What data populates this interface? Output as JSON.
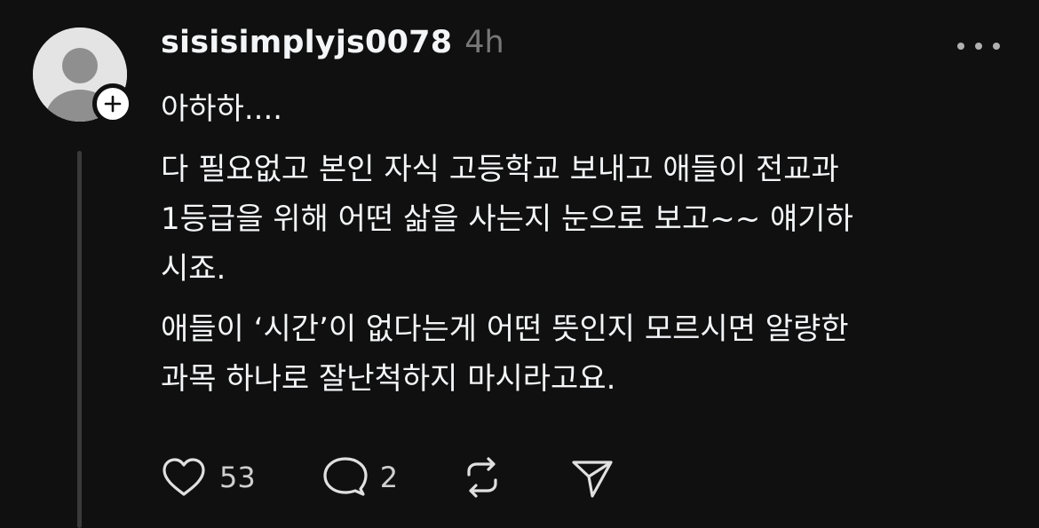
{
  "post": {
    "username": "sisisimplyjs0078",
    "timestamp": "4h",
    "paragraphs": [
      "아하하....",
      "다 필요없고 본인 자식 고등학교 보내고 애들이 전교과 1등급을 위해 어떤 삶을 사는지 눈으로 보고~~ 얘기하시죠.",
      "애들이 ‘시간’이 없다는게 어떤 뜻인지 모르시면 알량한 과목 하나로 잘난척하지 마시라고요."
    ],
    "lines": [
      [
        "아하하...."
      ],
      [
        "다 필요없고 본인 자식 고등학교 보내고 애들이 전교과",
        "1등급을 위해 어떤 삶을 사는지 눈으로 보고~~ 얘기하",
        "시죠."
      ],
      [
        "애들이 ‘시간’이 없다는게 어떤 뜻인지 모르시면 알량한",
        "과목 하나로 잘난척하지 마시라고요."
      ]
    ]
  },
  "actions": {
    "likes": "53",
    "replies": "2"
  },
  "icons": {
    "avatar": "default-user-avatar",
    "follow": "plus-icon",
    "more": "more-horizontal-icon",
    "like": "heart-icon",
    "reply": "comment-icon",
    "repost": "repost-icon",
    "share": "send-icon"
  },
  "colors": {
    "background": "#101010",
    "text": "#f3f5f7",
    "muted": "#777777",
    "thread_line": "#3a3a3a"
  }
}
